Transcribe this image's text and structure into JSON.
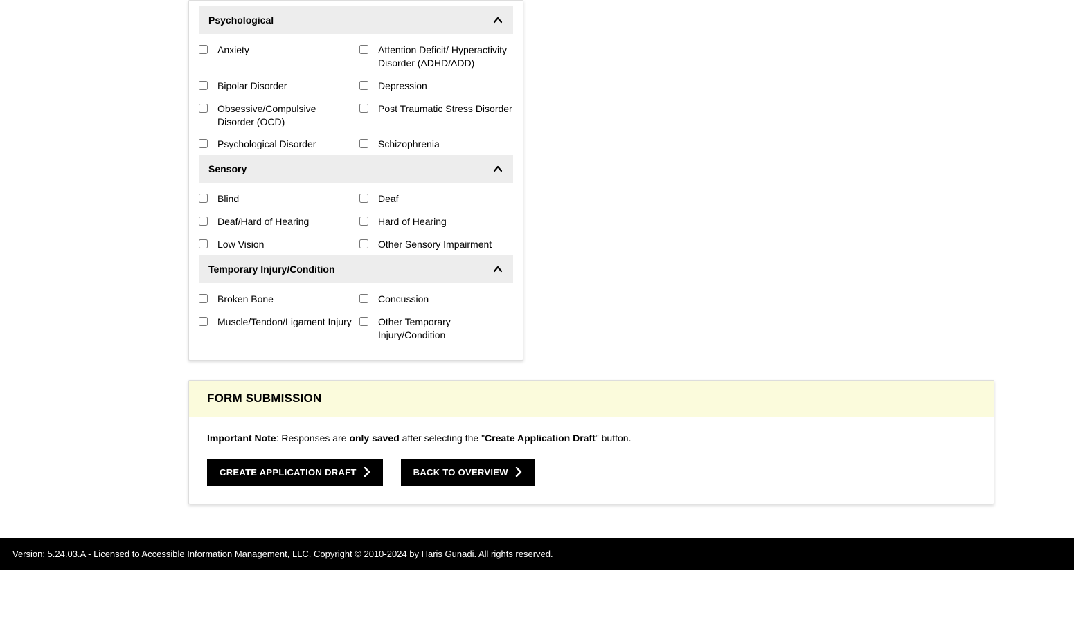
{
  "sections": [
    {
      "title": "Psychological",
      "items": [
        "Anxiety",
        "Attention Deficit/ Hyperactivity Disorder (ADHD/ADD)",
        "Bipolar Disorder",
        "Depression",
        "Obsessive/Compulsive Disorder (OCD)",
        "Post Traumatic Stress Disorder",
        "Psychological Disorder",
        "Schizophrenia"
      ]
    },
    {
      "title": "Sensory",
      "items": [
        "Blind",
        "Deaf",
        "Deaf/Hard of Hearing",
        "Hard of Hearing",
        "Low Vision",
        "Other Sensory Impairment"
      ]
    },
    {
      "title": "Temporary Injury/Condition",
      "items": [
        "Broken Bone",
        "Concussion",
        "Muscle/Tendon/Ligament Injury",
        "Other Temporary Injury/Condition"
      ]
    }
  ],
  "submission": {
    "header": "FORM SUBMISSION",
    "note_prefix": "Important Note",
    "note_mid1": ": Responses are ",
    "note_bold1": "only saved",
    "note_mid2": " after selecting the \"",
    "note_bold2": "Create Application Draft",
    "note_suffix": "\" button.",
    "btn_create": "CREATE APPLICATION DRAFT",
    "btn_back": "BACK TO OVERVIEW"
  },
  "footer": "Version: 5.24.03.A - Licensed to Accessible Information Management, LLC. Copyright © 2010-2024 by Haris Gunadi. All rights reserved."
}
